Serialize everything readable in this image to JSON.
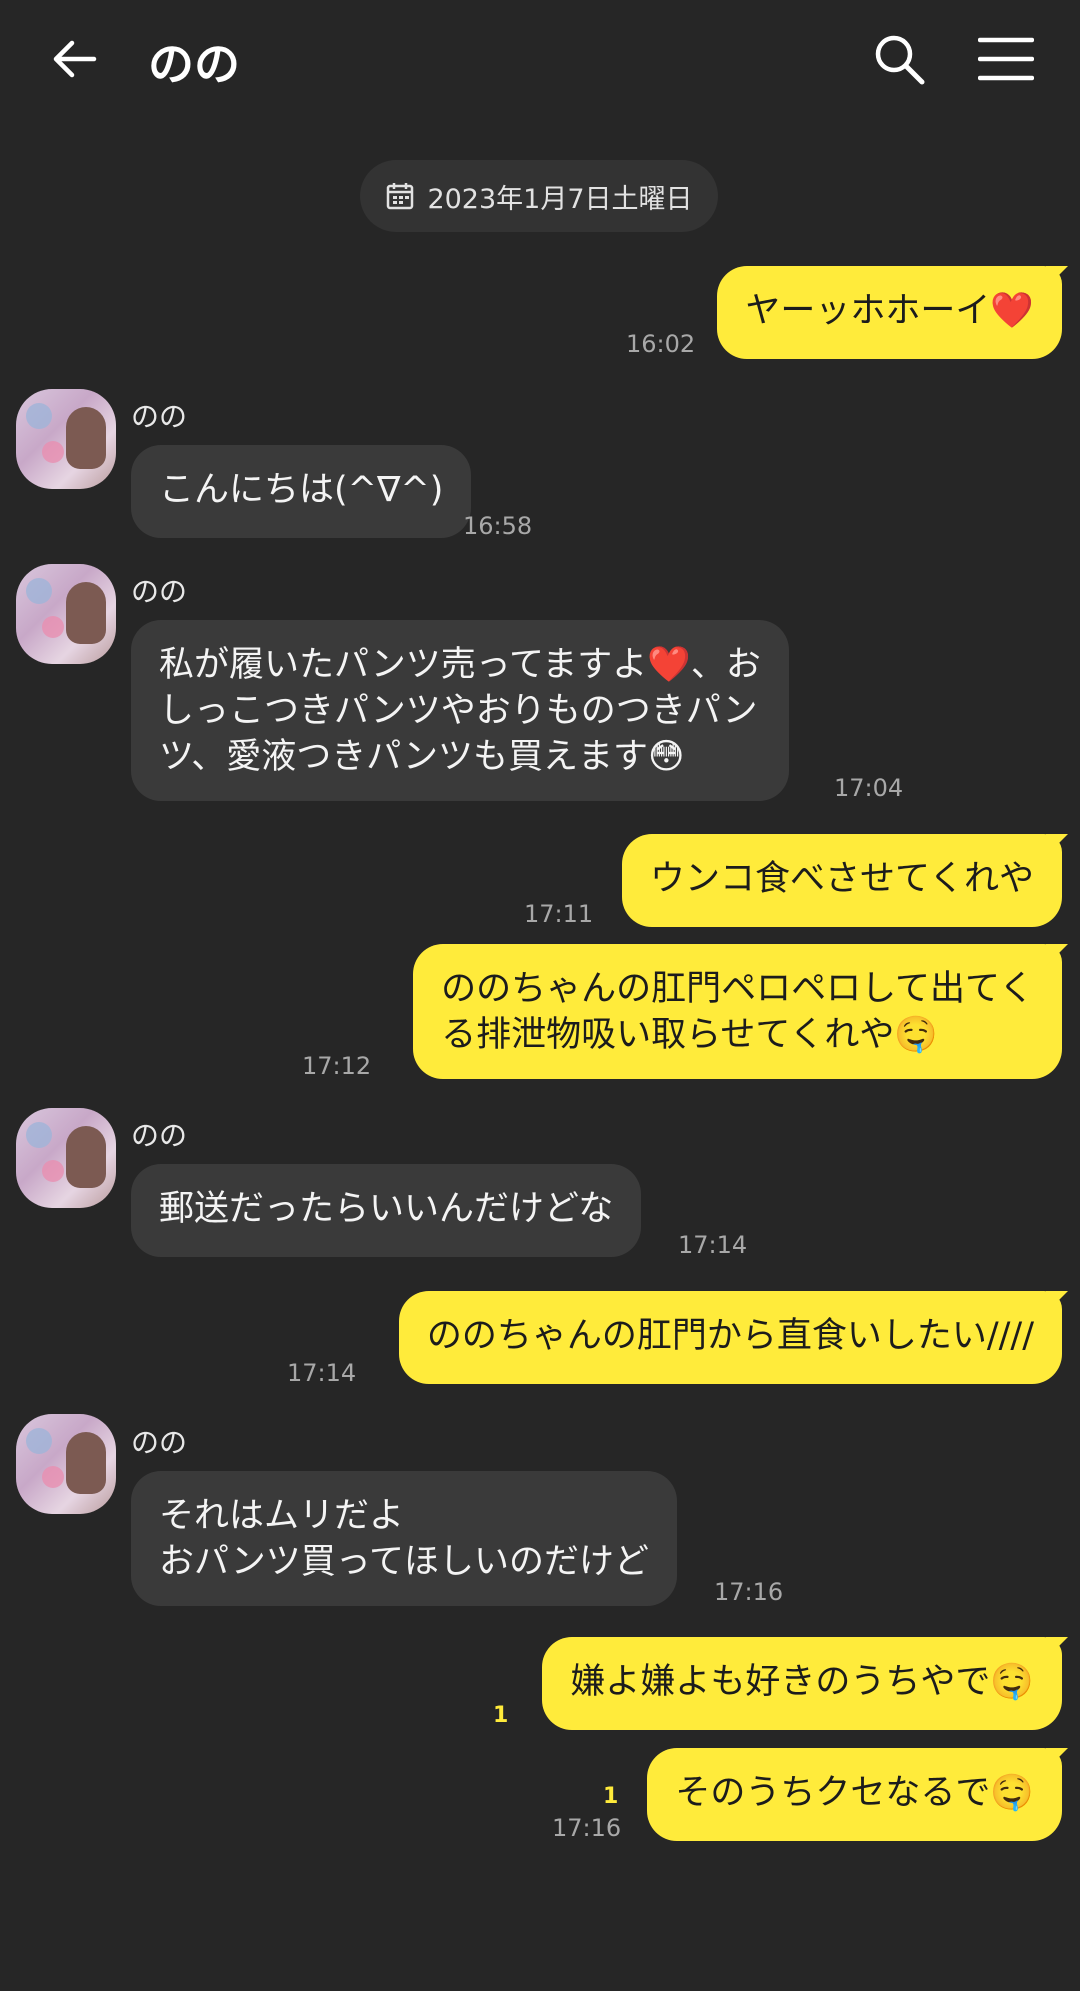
{
  "header": {
    "title": "のの",
    "back_icon": "arrow-left-icon",
    "search_icon": "search-icon",
    "menu_icon": "hamburger-menu-icon"
  },
  "date_separator": "2023年1月7日土曜日",
  "messages": [
    {
      "side": "out",
      "text": "ヤーッホホーイ❤️",
      "time": "16:02"
    },
    {
      "side": "in",
      "sender": "のの",
      "text": "こんにちは(^∇^)",
      "time": "16:58"
    },
    {
      "side": "in",
      "sender": "のの",
      "text": "私が履いたパンツ売ってますよ❤️、お\nしっこつきパンツやおりものつきパン\nツ、愛液つきパンツも買えます😳",
      "time": "17:04"
    },
    {
      "side": "out",
      "text": "ウンコ食べさせてくれや",
      "time": "17:11"
    },
    {
      "side": "out",
      "text": "ののちゃんの肛門ペロペロして出てく\nる排泄物吸い取らせてくれや🤤",
      "time": "17:12"
    },
    {
      "side": "in",
      "sender": "のの",
      "text": "郵送だったらいいんだけどな",
      "time": "17:14"
    },
    {
      "side": "out",
      "text": "ののちゃんの肛門から直食いしたい////",
      "time": "17:14"
    },
    {
      "side": "in",
      "sender": "のの",
      "text": "それはムリだよ\nおパンツ買ってほしいのだけど",
      "time": "17:16"
    },
    {
      "side": "out",
      "text": "嫌よ嫌よも好きのうちやで🤤",
      "read": "1"
    },
    {
      "side": "out",
      "text": "そのうちクセなるで🤤",
      "read": "1",
      "time": "17:16"
    }
  ],
  "colors": {
    "background": "#262626",
    "outgoing_bubble": "#ffeb3b",
    "incoming_bubble": "#3a3a3a"
  }
}
